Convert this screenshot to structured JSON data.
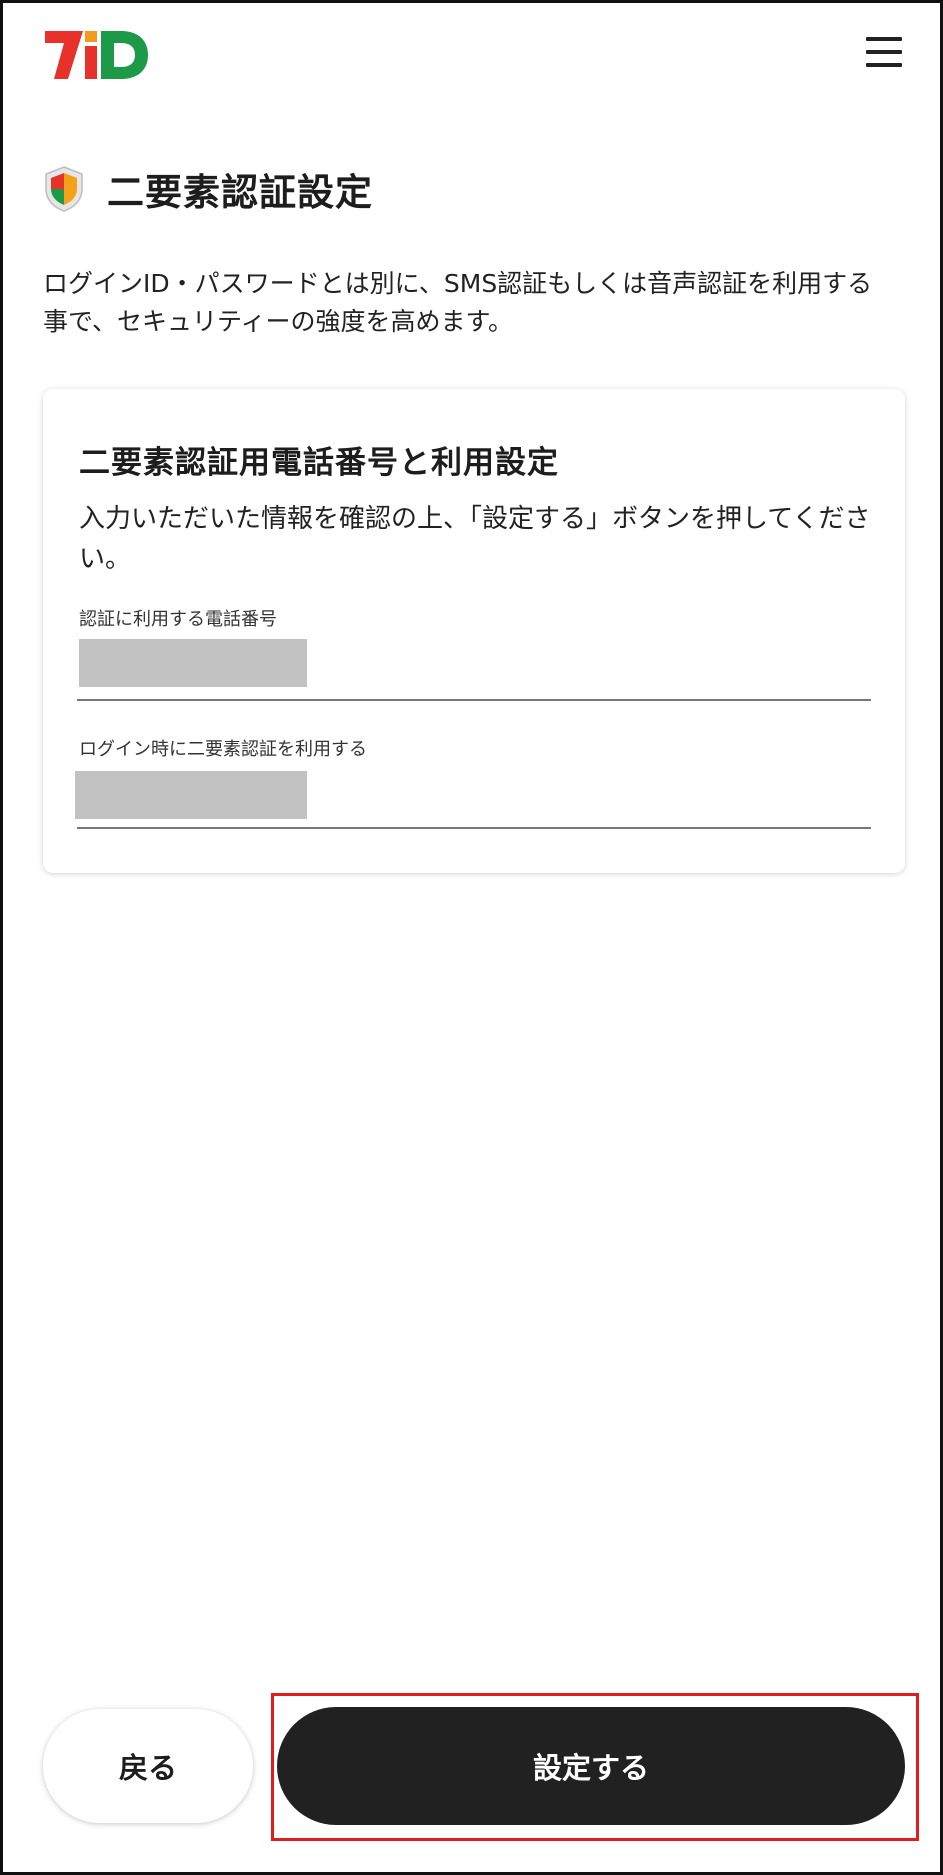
{
  "header": {
    "logo_text": "7iD",
    "menu_icon": "hamburger-menu-icon"
  },
  "page": {
    "title_icon": "shield-icon",
    "title": "二要素認証設定",
    "intro_line1": "ログインID・パスワードとは別に、SMS認証もしくは音声認証を利用する",
    "intro_line2": "事で、セキュリティーの強度を高めます。"
  },
  "card": {
    "title": "二要素認証用電話番号と利用設定",
    "desc_line1": "入力いただいた情報を確認の上、「設定する」ボタンを押してくださ",
    "desc_line2": "い。",
    "fields": [
      {
        "label": "認証に利用する電話番号",
        "value": ""
      },
      {
        "label": "ログイン時に二要素認証を利用する",
        "value": ""
      }
    ]
  },
  "actions": {
    "back_label": "戻る",
    "submit_label": "設定する"
  },
  "colors": {
    "primary_button": "#212121",
    "highlight": "#e01c1c",
    "logo_red": "#e8312a",
    "logo_green": "#1d9a47",
    "redacted": "#c2c2c2"
  }
}
